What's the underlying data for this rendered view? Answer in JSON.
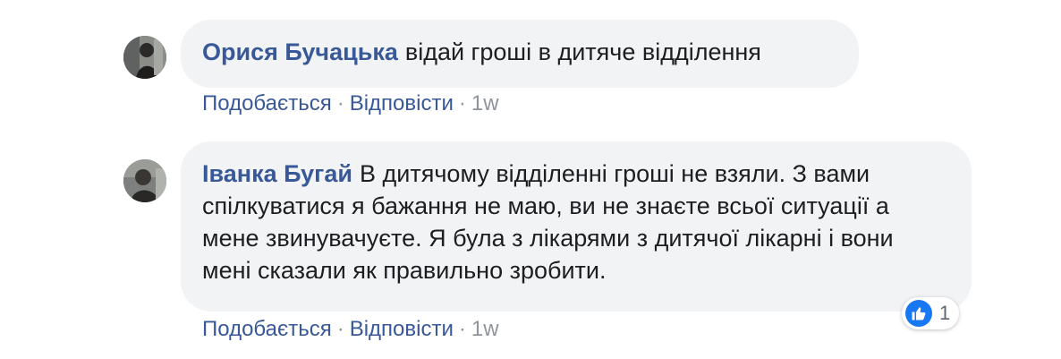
{
  "comments": [
    {
      "author": "Орися Бучацька",
      "text": "відай гроші в дитяче відділення",
      "actions": {
        "like": "Подобається",
        "reply": "Відповісти",
        "time": "1w"
      }
    },
    {
      "author": "Іванка Бугай",
      "text": "В дитячому відділенні гроші не взяли. З вами спілкуватися я бажання не маю, ви не знаєте всьої ситуації а мене звинувачуєте. Я була з лікарями з дитячої лікарні і вони мені сказали як правильно зробити.",
      "actions": {
        "like": "Подобається",
        "reply": "Відповісти",
        "time": "1w"
      },
      "reactions": {
        "icon": "thumbs-up-icon",
        "count": "1"
      }
    }
  ],
  "colors": {
    "author": "#385898",
    "bubble": "#f2f3f5",
    "like_badge": "#1877f2"
  }
}
